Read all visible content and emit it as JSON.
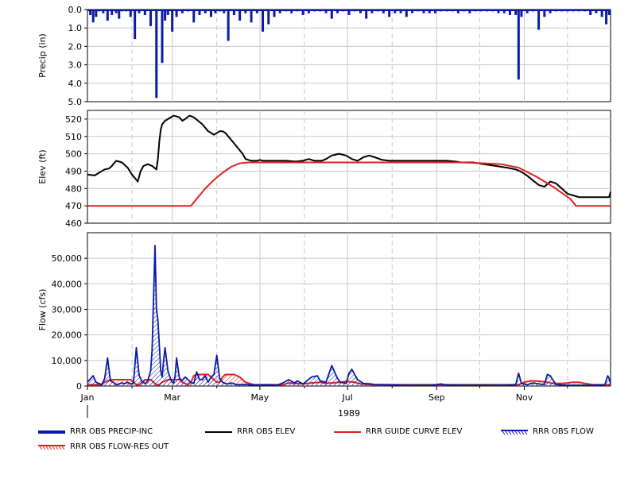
{
  "chart_data": [
    {
      "type": "bar",
      "panel": "precip",
      "ylabel": "Precip (in)",
      "ylim": [
        5.0,
        0.0
      ],
      "inverted": true,
      "yticks": [
        "0.0",
        "1.0",
        "2.0",
        "3.0",
        "4.0",
        "5.0"
      ],
      "grid": true,
      "series": [
        {
          "name": "RRR OBS PRECIP-INC",
          "color": "#0a1aa8",
          "x_day": [
            2,
            4,
            6,
            8,
            11,
            14,
            17,
            20,
            22,
            24,
            27,
            30,
            33,
            36,
            40,
            44,
            48,
            52,
            54,
            56,
            59,
            62,
            66,
            70,
            74,
            78,
            82,
            86,
            89,
            92,
            95,
            98,
            102,
            106,
            110,
            114,
            118,
            122,
            126,
            130,
            134,
            138,
            142,
            146,
            150,
            154,
            158,
            162,
            166,
            170,
            174,
            178,
            182,
            186,
            190,
            194,
            198,
            202,
            206,
            210,
            214,
            218,
            222,
            226,
            230,
            234,
            238,
            242,
            246,
            250,
            254,
            258,
            262,
            266,
            270,
            274,
            278,
            282,
            286,
            290,
            294,
            298,
            300,
            302,
            306,
            310,
            314,
            318,
            322,
            326,
            330,
            334,
            338,
            342,
            346,
            350,
            354,
            358,
            361,
            363
          ],
          "values": [
            0.3,
            0.7,
            0.4,
            0.1,
            0.2,
            0.6,
            0.3,
            0.2,
            0.5,
            0.1,
            0.1,
            0.4,
            1.6,
            0.2,
            0.3,
            0.9,
            4.8,
            2.9,
            0.6,
            0.3,
            1.2,
            0.4,
            0.2,
            0.1,
            0.7,
            0.3,
            0.2,
            0.4,
            0.2,
            0.1,
            0.2,
            1.7,
            0.3,
            0.6,
            0.2,
            0.7,
            0.2,
            1.2,
            0.8,
            0.4,
            0.2,
            0.1,
            0.2,
            0.1,
            0.3,
            0.2,
            0.1,
            0.1,
            0.2,
            0.5,
            0.2,
            0.1,
            0.3,
            0.1,
            0.2,
            0.5,
            0.2,
            0.1,
            0.2,
            0.4,
            0.2,
            0.2,
            0.4,
            0.2,
            0.1,
            0.2,
            0.2,
            0.2,
            0.1,
            0.1,
            0.1,
            0.2,
            0.1,
            0.2,
            0.1,
            0.1,
            0.1,
            0.1,
            0.2,
            0.2,
            0.3,
            0.3,
            3.8,
            0.4,
            0.2,
            0.1,
            1.1,
            0.4,
            0.2,
            0.1,
            0.1,
            0.1,
            0.1,
            0.1,
            0.1,
            0.3,
            0.2,
            0.4,
            0.8,
            0.3
          ]
        }
      ]
    },
    {
      "type": "line",
      "panel": "elev",
      "ylabel": "Elev (ft)",
      "ylim": [
        460,
        525
      ],
      "yticks": [
        "460",
        "470",
        "480",
        "490",
        "500",
        "510",
        "520"
      ],
      "grid": true,
      "series": [
        {
          "name": "RRR OBS ELEV",
          "color": "#000000",
          "x_day": [
            0,
            5,
            8,
            12,
            15,
            17,
            20,
            24,
            28,
            31,
            33,
            35,
            37,
            39,
            42,
            45,
            48,
            49,
            50,
            51,
            52,
            53,
            54,
            56,
            60,
            64,
            66,
            68,
            71,
            74,
            77,
            80,
            84,
            86,
            88,
            92,
            94,
            96,
            98,
            100,
            104,
            108,
            110,
            114,
            118,
            120,
            122,
            125,
            128,
            133,
            138,
            145,
            150,
            154,
            158,
            163,
            166,
            170,
            175,
            180,
            184,
            188,
            192,
            196,
            200,
            205,
            210,
            214,
            218,
            222,
            226,
            230,
            236,
            240,
            246,
            250,
            256,
            260,
            268,
            276,
            284,
            292,
            298,
            301,
            305,
            308,
            311,
            314,
            318,
            322,
            326,
            330,
            334,
            338,
            342,
            346,
            350,
            356,
            361,
            363,
            364
          ],
          "values": [
            488,
            487.5,
            489,
            491,
            491.5,
            493,
            496,
            495,
            492,
            488,
            486,
            484,
            490,
            493,
            494,
            493,
            491,
            497,
            507,
            514,
            517,
            518,
            519,
            520,
            522,
            521,
            519,
            520,
            522,
            521,
            519,
            517,
            513,
            512,
            511,
            513,
            513,
            512,
            510,
            508,
            504,
            500,
            497,
            496,
            496,
            496.5,
            496,
            496,
            496,
            496,
            496,
            495.5,
            496,
            497,
            496,
            496,
            497,
            499,
            500,
            499,
            497,
            496,
            498,
            499,
            498,
            496.5,
            496,
            496,
            496,
            496,
            496,
            496,
            496,
            496,
            496,
            496,
            495.5,
            495,
            495,
            494,
            493,
            492,
            491,
            490,
            488,
            486,
            484,
            482,
            481,
            484,
            483,
            480,
            477,
            476,
            475,
            475,
            475,
            475,
            475,
            475,
            478
          ]
        },
        {
          "name": "RRR GUIDE CURVE ELEV",
          "color": "#e02020",
          "x_day": [
            0,
            72,
            76,
            82,
            88,
            94,
            100,
            106,
            112,
            140,
            180,
            220,
            260,
            276,
            288,
            300,
            312,
            324,
            336,
            340,
            364
          ],
          "values": [
            470,
            470,
            474,
            480,
            485,
            489,
            492.5,
            494.5,
            495,
            495,
            495,
            495,
            495,
            494.5,
            494,
            492,
            487,
            481,
            474,
            470,
            470
          ]
        }
      ]
    },
    {
      "type": "area",
      "panel": "flow",
      "ylabel": "Flow (cfs)",
      "ylim": [
        0,
        60000
      ],
      "yticks": [
        "0",
        "10,000",
        "20,000",
        "30,000",
        "40,000",
        "50,000"
      ],
      "xlabel": "1989",
      "xticks": [
        "Jan",
        "Mar",
        "May",
        "Jul",
        "Sep",
        "Nov"
      ],
      "xtick_days": [
        0,
        59,
        120,
        181,
        243,
        304
      ],
      "minor_tick_days": [
        31,
        90,
        151,
        212,
        273,
        334
      ],
      "grid": true,
      "series": [
        {
          "name": "RRR OBS FLOW",
          "color": "#0a1aa8",
          "fill": "hatch",
          "x_day": [
            0,
            4,
            6,
            8,
            10,
            12,
            14,
            16,
            18,
            20,
            22,
            24,
            26,
            28,
            30,
            32,
            34,
            36,
            38,
            40,
            42,
            44,
            45,
            46,
            47,
            48,
            49,
            50,
            51,
            52,
            53,
            54,
            56,
            58,
            59,
            60,
            61,
            62,
            64,
            66,
            68,
            70,
            72,
            74,
            76,
            78,
            80,
            82,
            84,
            86,
            88,
            90,
            92,
            94,
            96,
            98,
            100,
            104,
            110,
            114,
            120,
            128,
            132,
            136,
            140,
            144,
            146,
            150,
            156,
            160,
            162,
            166,
            170,
            174,
            176,
            180,
            182,
            184,
            188,
            192,
            196,
            200,
            210,
            220,
            230,
            240,
            246,
            250,
            260,
            270,
            280,
            290,
            298,
            300,
            302,
            306,
            310,
            314,
            318,
            320,
            322,
            326,
            330,
            334,
            338,
            342,
            346,
            350,
            354,
            360,
            362,
            363,
            364
          ],
          "values": [
            1500,
            4000,
            1500,
            1000,
            600,
            3000,
            11000,
            2000,
            1500,
            500,
            800,
            1200,
            900,
            1500,
            700,
            1200,
            15000,
            4000,
            1800,
            900,
            2000,
            6000,
            14000,
            35000,
            55000,
            30000,
            26000,
            16000,
            6000,
            3500,
            10000,
            15000,
            6000,
            2500,
            1500,
            1200,
            4000,
            11000,
            3000,
            2200,
            3500,
            2500,
            1400,
            1000,
            5500,
            2500,
            2500,
            4000,
            1500,
            3500,
            4500,
            12000,
            3000,
            1500,
            1000,
            800,
            1200,
            500,
            600,
            400,
            400,
            500,
            300,
            1200,
            2500,
            1200,
            2000,
            800,
            3500,
            4000,
            2000,
            1500,
            8000,
            3000,
            1500,
            1000,
            5000,
            6500,
            2500,
            1000,
            900,
            600,
            500,
            300,
            300,
            300,
            800,
            400,
            300,
            300,
            300,
            300,
            500,
            5000,
            1000,
            500,
            1200,
            800,
            600,
            4500,
            4000,
            600,
            400,
            300,
            300,
            300,
            300,
            300,
            300,
            500,
            4000,
            3000,
            800
          ]
        },
        {
          "name": "RRR OBS FLOW-RES OUT",
          "color": "#e02020",
          "fill": "hatch",
          "x_day": [
            0,
            10,
            12,
            16,
            22,
            26,
            30,
            32,
            34,
            36,
            38,
            40,
            44,
            46,
            48,
            50,
            52,
            56,
            60,
            64,
            66,
            70,
            72,
            74,
            76,
            80,
            84,
            86,
            90,
            92,
            94,
            96,
            100,
            102,
            106,
            110,
            114,
            116,
            120,
            124,
            130,
            136,
            140,
            144,
            150,
            156,
            162,
            166,
            170,
            176,
            180,
            186,
            190,
            196,
            200,
            206,
            210,
            216,
            220,
            230,
            240,
            250,
            260,
            270,
            280,
            290,
            296,
            300,
            304,
            308,
            312,
            316,
            320,
            324,
            330,
            334,
            338,
            342,
            346,
            352,
            358,
            364
          ],
          "values": [
            500,
            500,
            1500,
            2500,
            2500,
            2500,
            2500,
            1500,
            500,
            500,
            1500,
            2500,
            2500,
            1500,
            500,
            500,
            1500,
            2500,
            2500,
            2500,
            1500,
            500,
            1500,
            4000,
            4500,
            4500,
            4500,
            3500,
            1500,
            1500,
            3500,
            4500,
            4500,
            4500,
            3500,
            1500,
            800,
            500,
            500,
            500,
            500,
            500,
            1200,
            1000,
            800,
            1200,
            1500,
            1000,
            1200,
            1500,
            1800,
            1500,
            800,
            600,
            500,
            500,
            500,
            500,
            500,
            500,
            500,
            500,
            500,
            500,
            500,
            500,
            500,
            500,
            1500,
            2000,
            2000,
            1800,
            1500,
            1000,
            1000,
            1200,
            1500,
            1500,
            1000,
            500,
            500,
            500
          ]
        }
      ]
    }
  ],
  "legend": [
    {
      "label": "RRR OBS PRECIP-INC",
      "style": "thick",
      "color": "#0a1aa8"
    },
    {
      "label": "RRR OBS ELEV",
      "style": "line",
      "color": "#000000"
    },
    {
      "label": "RRR GUIDE CURVE ELEV",
      "style": "line",
      "color": "#e02020"
    },
    {
      "label": "RRR OBS FLOW",
      "style": "hatch",
      "color": "#0a1aa8"
    },
    {
      "label": "RRR OBS FLOW-RES OUT",
      "style": "hatch",
      "color": "#e02020"
    }
  ]
}
